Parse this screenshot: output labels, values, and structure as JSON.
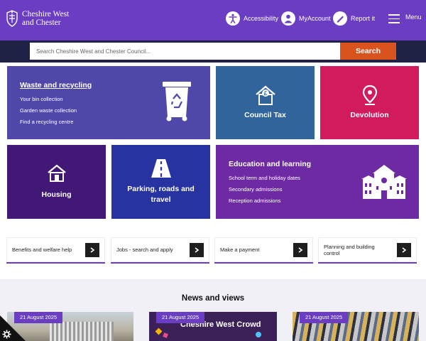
{
  "header": {
    "logo_line1": "Cheshire West",
    "logo_line2": "and Chester",
    "nav": {
      "accessibility": "Accessibility",
      "my_account": "MyAccount",
      "report_it": "Report it",
      "menu": "Menu"
    }
  },
  "search": {
    "placeholder": "Search Cheshire West and Chester Council...",
    "button_label": "Search"
  },
  "tiles": {
    "waste": {
      "title": "Waste and recycling",
      "links": [
        "Your bin collection",
        "Garden waste collection",
        "Find a recycling centre"
      ],
      "icon": "wheelie-bin-icon",
      "color": "#4f48a8"
    },
    "council_tax": {
      "title": "Council Tax",
      "icon": "house-pound-icon",
      "color": "#30649a"
    },
    "devolution": {
      "title": "Devolution",
      "icon": "map-pin-icon",
      "color": "#d11b5c"
    },
    "housing": {
      "title": "Housing",
      "icon": "house-icon",
      "color": "#421877"
    },
    "parking": {
      "title_line1": "Parking, roads and",
      "title_line2": "travel",
      "icon": "road-icon",
      "color": "#2733a1"
    },
    "education": {
      "title": "Education and learning",
      "links": [
        "School term and holiday dates",
        "Secondary admissions",
        "Reception admissions"
      ],
      "icon": "school-icon",
      "color": "#6e2aa3"
    }
  },
  "quick_links": [
    {
      "label": "Benefits and welfare help"
    },
    {
      "label": "Jobs - search and apply"
    },
    {
      "label": "Make a payment"
    },
    {
      "label": "Planning and building control"
    }
  ],
  "news": {
    "title": "News and views",
    "cards": [
      {
        "date": "21 August 2025"
      },
      {
        "date": "21 August 2025",
        "banner_text": "Cheshire West Crowd"
      },
      {
        "date": "21 August 2025"
      }
    ]
  },
  "colors": {
    "header_purple": "#6a3dc3",
    "search_band": "#1f2245",
    "search_button": "#d9531e"
  }
}
